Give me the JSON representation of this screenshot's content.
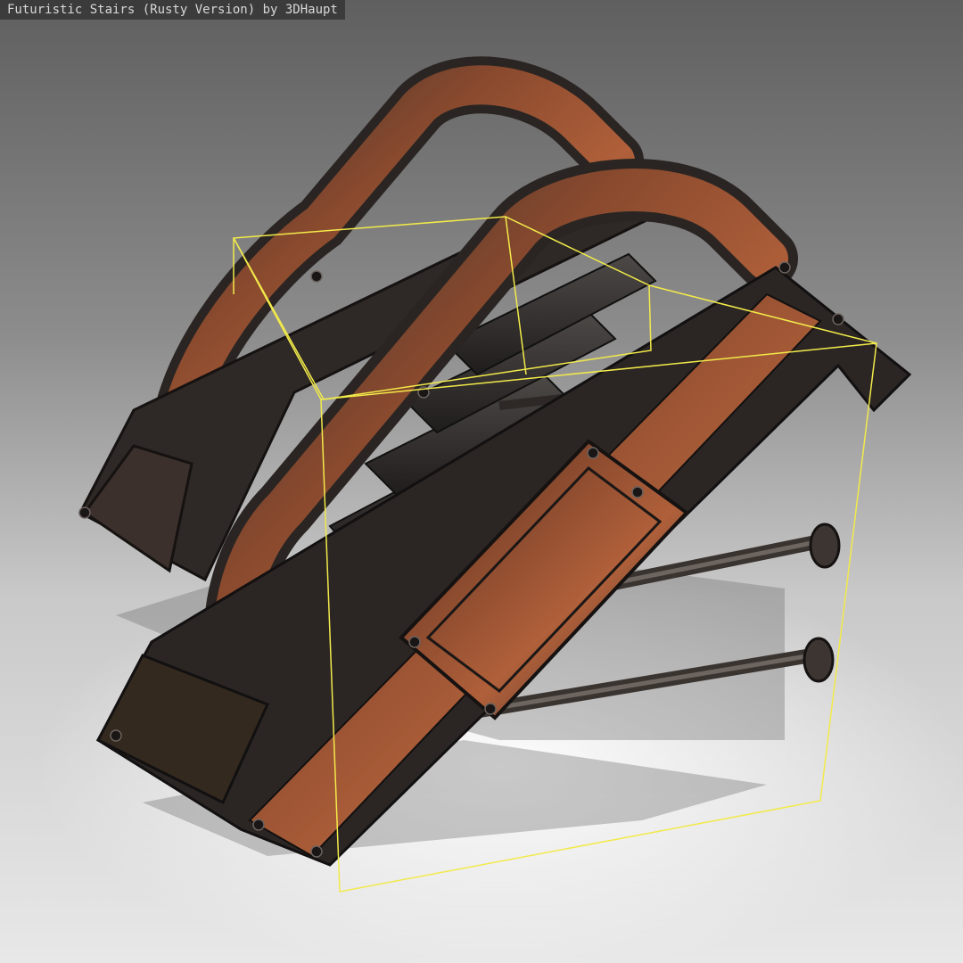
{
  "viewer": {
    "title": "Futuristic Stairs (Rusty Version) by 3DHaupt"
  },
  "scene": {
    "model": "futuristic-stairs",
    "material": "rusty-metal",
    "bounding_box_visible": true
  },
  "colors": {
    "background_top": "#5f5f5f",
    "background_bottom": "#e8e8e8",
    "bounding_box": "#f2ea4a",
    "rust": "#a0522d",
    "dark_metal": "#2a2522",
    "steel": "#4a4540"
  }
}
